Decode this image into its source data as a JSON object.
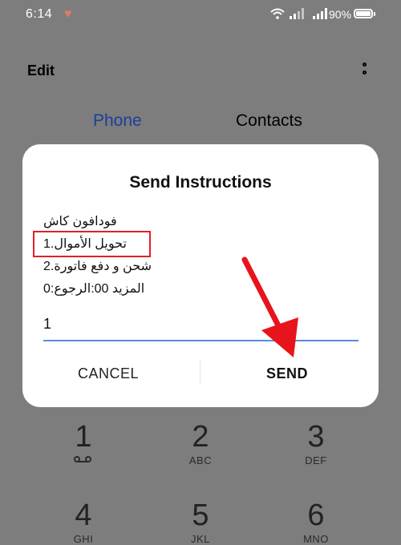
{
  "status_bar": {
    "time": "6:14",
    "battery": "90%",
    "battery_level": 0.9
  },
  "header": {
    "edit_label": "Edit",
    "more_icon": "more-vertical-icon"
  },
  "tabs": [
    {
      "label": "Phone",
      "active": true,
      "color": "#1d3e9a"
    },
    {
      "label": "Contacts",
      "active": false
    }
  ],
  "dialog": {
    "title": "Send Instructions",
    "message_lines": [
      "فودافون كاش",
      "تحويل الأموال.1",
      "شحن و دفع فاتورة.2",
      "المزيد 00:الرجوع:0"
    ],
    "input_value": "1",
    "cancel_label": "CANCEL",
    "send_label": "SEND",
    "highlight_color": "#e0202a",
    "arrow_color": "#e8141c"
  },
  "dialpad": [
    {
      "digit": "1",
      "letters": "",
      "icon": "voicemail-icon"
    },
    {
      "digit": "2",
      "letters": "ABC"
    },
    {
      "digit": "3",
      "letters": "DEF"
    },
    {
      "digit": "4",
      "letters": "GHI"
    },
    {
      "digit": "5",
      "letters": "JKL"
    },
    {
      "digit": "6",
      "letters": "MNO"
    }
  ]
}
